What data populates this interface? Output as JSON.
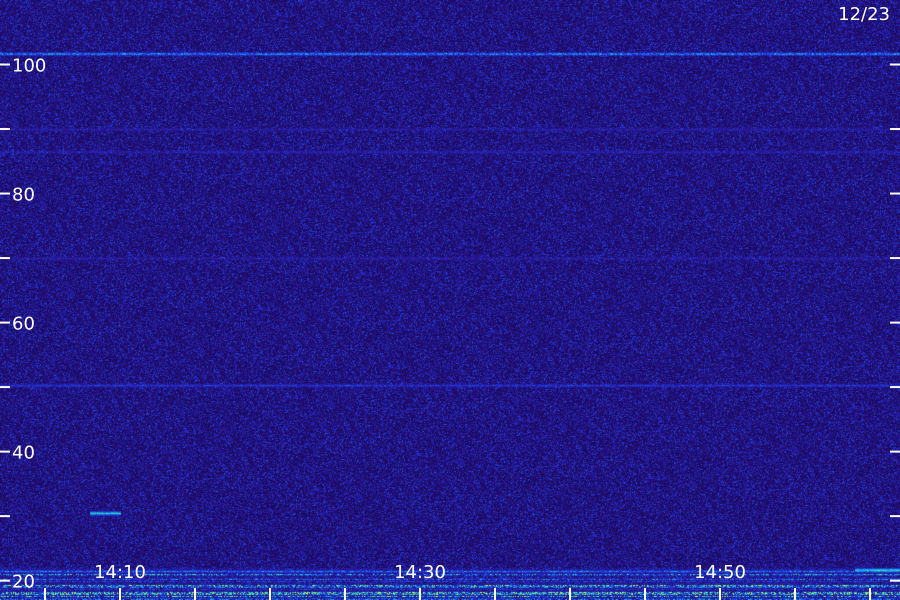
{
  "date_label": "12/23",
  "chart_data": {
    "type": "heatmap",
    "title": "",
    "xlabel": "",
    "ylabel": "",
    "colormap": [
      "#1c0a5e",
      "#2a1690",
      "#1e2ed6",
      "#1a6ee8",
      "#19b7e0",
      "#3ef0a0",
      "#d8ff40"
    ],
    "background": "#1c0a5e",
    "grid": false,
    "ylim": [
      17,
      110
    ],
    "y_ticks": [
      20,
      30,
      40,
      50,
      60,
      70,
      80,
      90,
      100
    ],
    "y_tick_labels": [
      "20",
      "40",
      "60",
      "80",
      "100"
    ],
    "y_tick_label_values": [
      20,
      40,
      60,
      80,
      100
    ],
    "xlim": [
      "14:02",
      "15:02"
    ],
    "x_ticks": [
      "14:05",
      "14:10",
      "14:15",
      "14:20",
      "14:25",
      "14:30",
      "14:35",
      "14:40",
      "14:45",
      "14:50",
      "14:55",
      "15:00"
    ],
    "x_tick_labels": [
      "14:10",
      "14:30",
      "14:50"
    ],
    "features": [
      {
        "kind": "band",
        "y": 101.7,
        "intensity": 0.85
      },
      {
        "kind": "band",
        "y": 90,
        "intensity": 0.3
      },
      {
        "kind": "band",
        "y": 86.5,
        "intensity": 0.35
      },
      {
        "kind": "band",
        "y": 70,
        "intensity": 0.3
      },
      {
        "kind": "band",
        "y": 50.3,
        "intensity": 0.5
      },
      {
        "kind": "segment",
        "y": 30.5,
        "x_from": "14:08",
        "x_to": "14:10",
        "intensity": 0.9
      },
      {
        "kind": "band",
        "y": 21.5,
        "intensity": 0.7
      },
      {
        "kind": "segment",
        "y": 21.7,
        "x_from": "14:59",
        "x_to": "15:02",
        "intensity": 0.95
      }
    ],
    "low_noise_floor_below": 22
  }
}
